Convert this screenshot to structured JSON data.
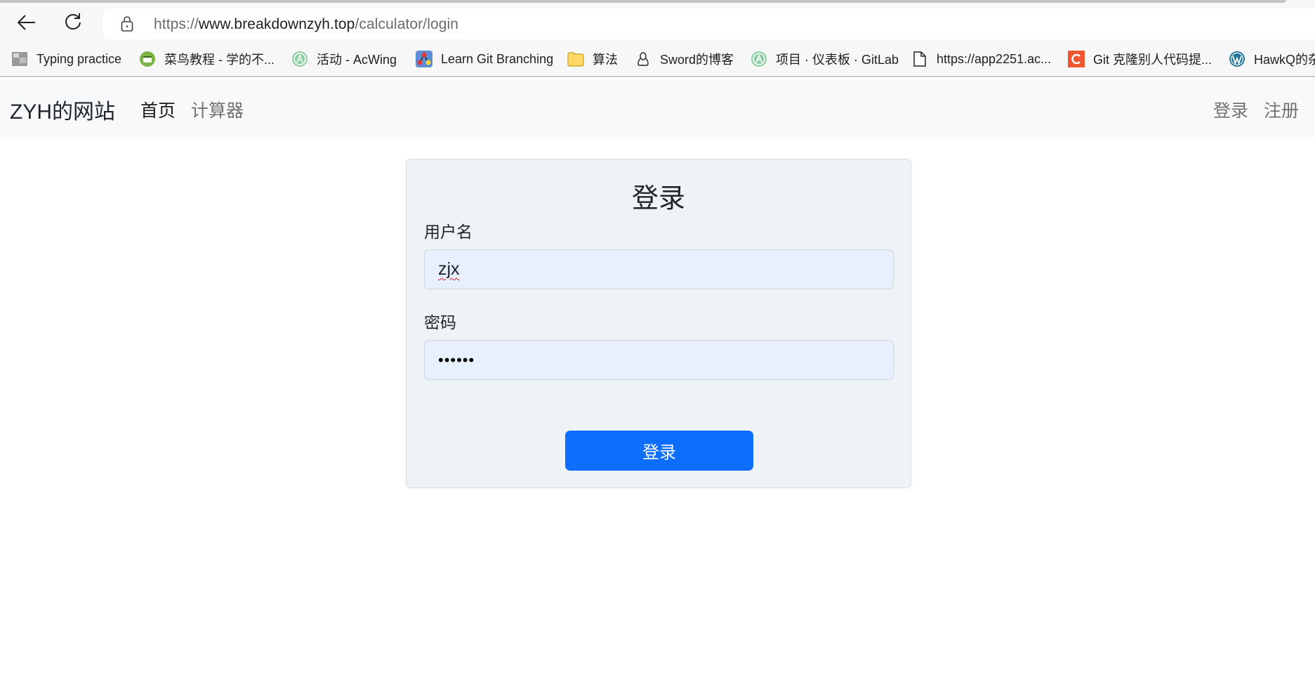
{
  "browser": {
    "url_scheme": "https://",
    "url_host": "www.breakdownzyh.top",
    "url_path": "/calculator/login",
    "bookmarks": [
      {
        "label": "Typing practice",
        "icon": "typing-practice-icon"
      },
      {
        "label": "菜鸟教程 - 学的不...",
        "icon": "runoob-icon"
      },
      {
        "label": "活动 - AcWing",
        "icon": "acwing-icon"
      },
      {
        "label": "Learn Git Branching",
        "icon": "git-branching-icon"
      },
      {
        "label": "算法",
        "icon": "folder-icon"
      },
      {
        "label": "Sword的博客",
        "icon": "penguin-icon"
      },
      {
        "label": "项目 · 仪表板 · GitLab",
        "icon": "acwing-icon"
      },
      {
        "label": "https://app2251.ac...",
        "icon": "page-icon"
      },
      {
        "label": "Git 克隆别人代码提...",
        "icon": "c-logo-icon"
      },
      {
        "label": "HawkQ的杂",
        "icon": "wordpress-icon"
      }
    ]
  },
  "navbar": {
    "brand": "ZYH的网站",
    "links": [
      {
        "label": "首页",
        "active": true
      },
      {
        "label": "计算器",
        "active": false
      }
    ],
    "right_links": [
      {
        "label": "登录"
      },
      {
        "label": "注册"
      }
    ]
  },
  "login": {
    "title": "登录",
    "username_label": "用户名",
    "username_value": "zjx",
    "password_label": "密码",
    "password_mask": "••••••",
    "submit_label": "登录"
  },
  "colors": {
    "primary": "#0d6efd",
    "navbar_bg": "#f8f9fa",
    "card_bg": "#eef3f8",
    "input_autofill_bg": "#e8f0fe"
  }
}
